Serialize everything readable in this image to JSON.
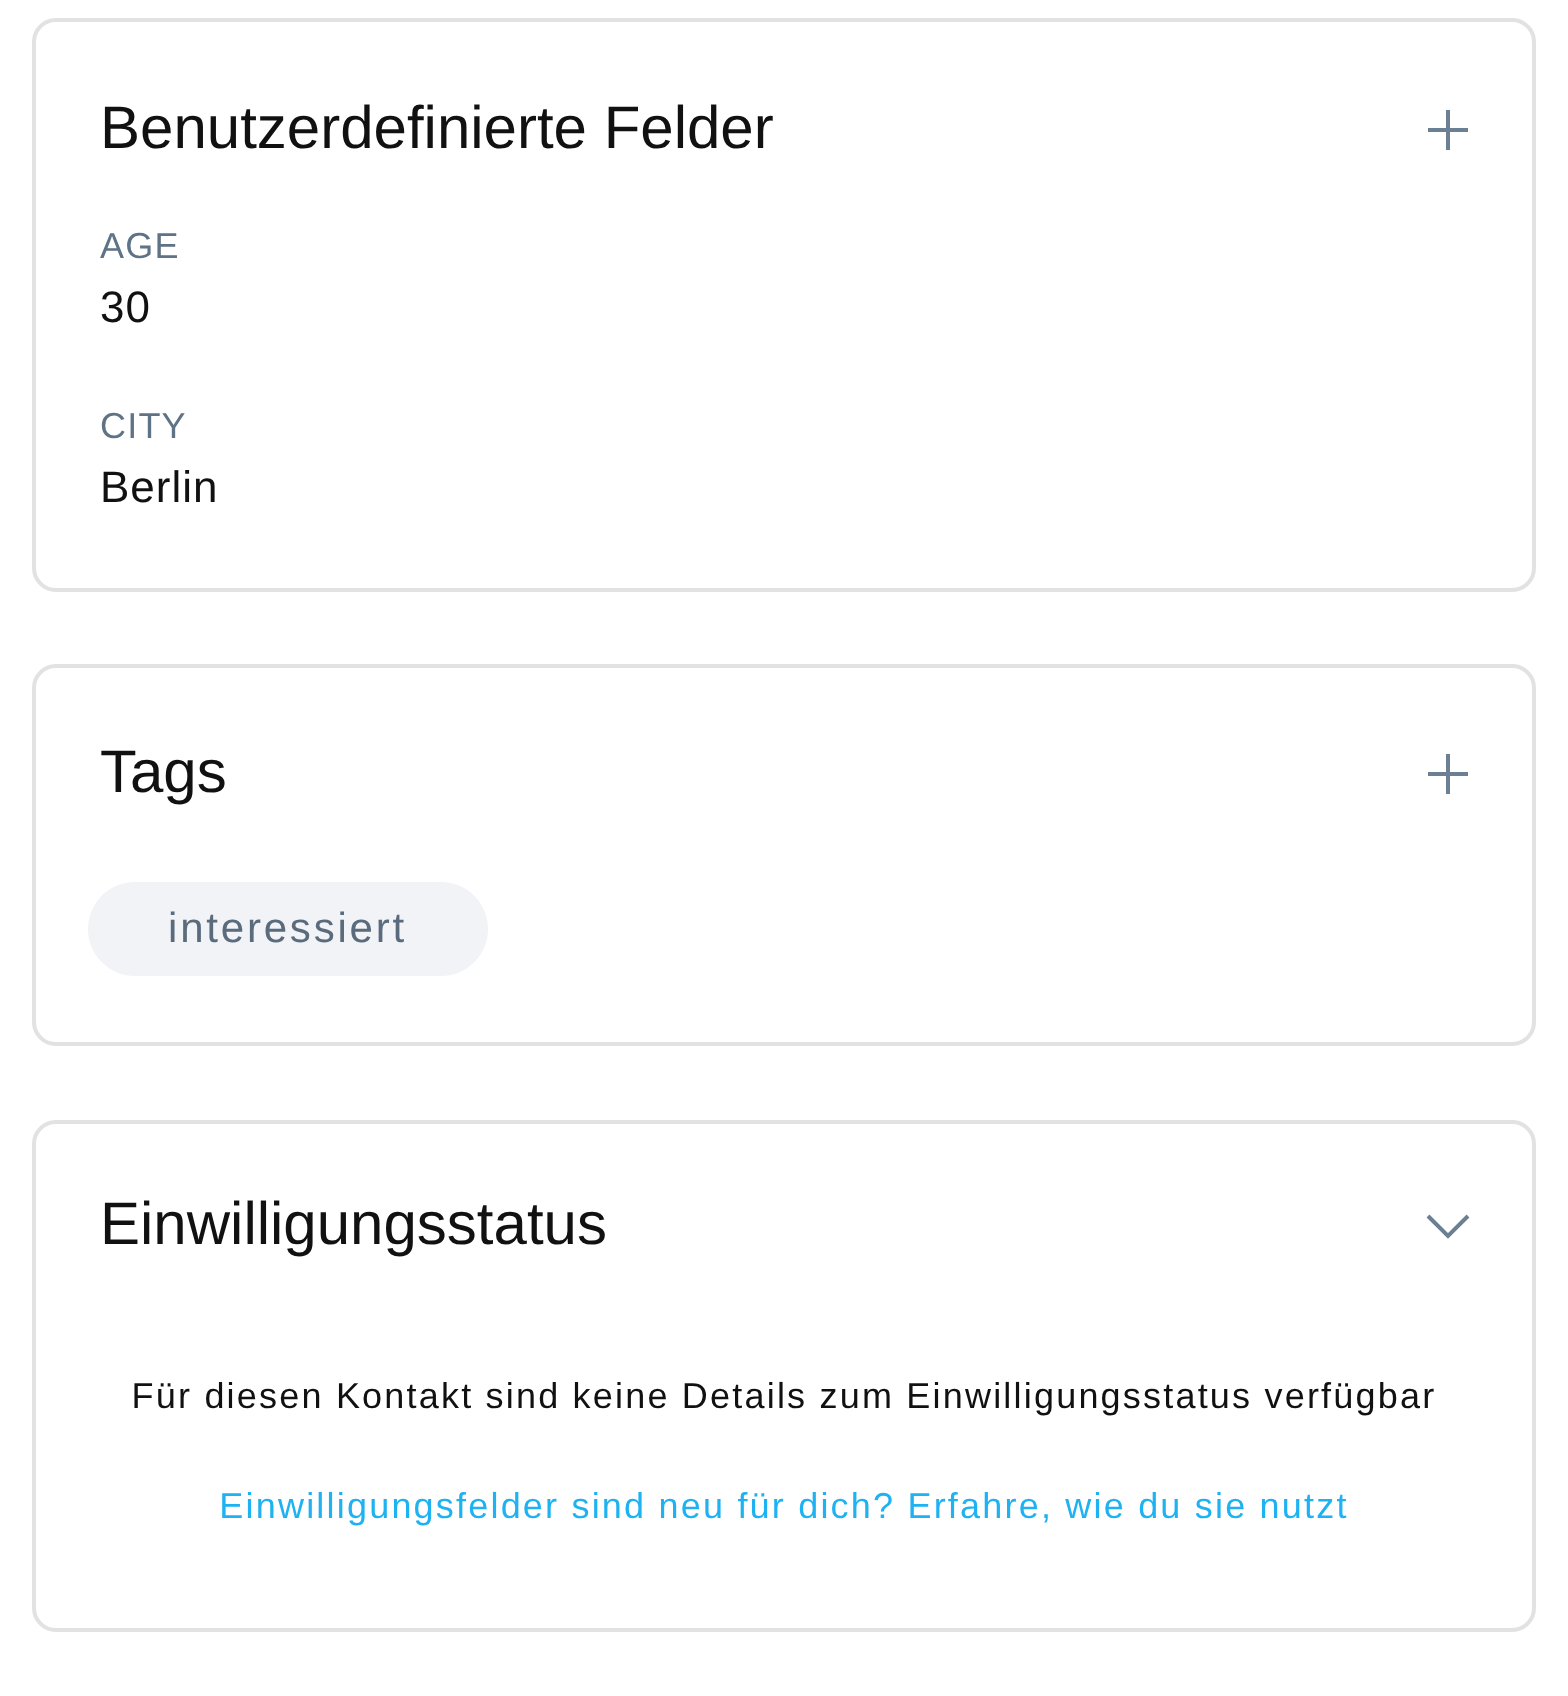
{
  "cards": [
    {
      "kind": "fields",
      "title": "Benutzerdefinierte Felder",
      "fields": [
        {
          "label": "AGE",
          "value": "30"
        },
        {
          "label": "CITY",
          "value": "Berlin"
        }
      ]
    },
    {
      "kind": "tags",
      "title": "Tags",
      "tags": [
        "interessiert"
      ]
    },
    {
      "kind": "message",
      "title": "Einwilligungsstatus",
      "message": "Für diesen Kontakt sind keine Details zum Einwilligungsstatus verfügbar",
      "link": "Einwilligungsfelder sind neu für dich? Erfahre, wie du sie nutzt"
    }
  ]
}
